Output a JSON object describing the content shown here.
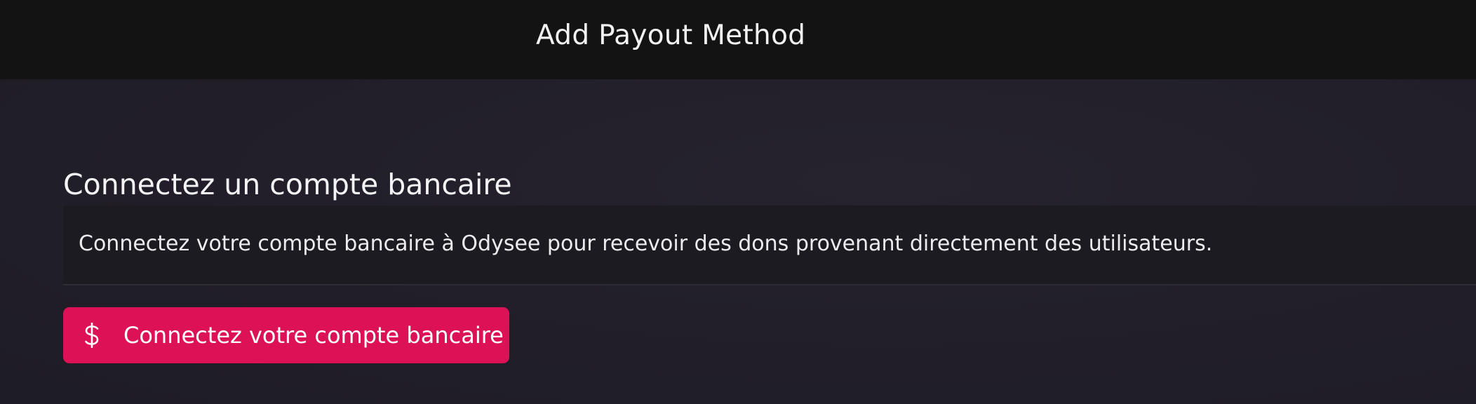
{
  "header": {
    "title": "Add Payout Method"
  },
  "bank_section": {
    "title": "Connectez un compte bancaire",
    "description": "Connectez votre compte bancaire à Odysee pour recevoir des dons provenant directement des utilisateurs.",
    "button": {
      "icon": "dollar-icon",
      "label": "Connectez votre compte bancaire",
      "color": "#dd1155"
    }
  },
  "colors": {
    "topbar": "#131313",
    "background": "#211f29",
    "card": "#1c1b21",
    "accent": "#dd1155"
  }
}
